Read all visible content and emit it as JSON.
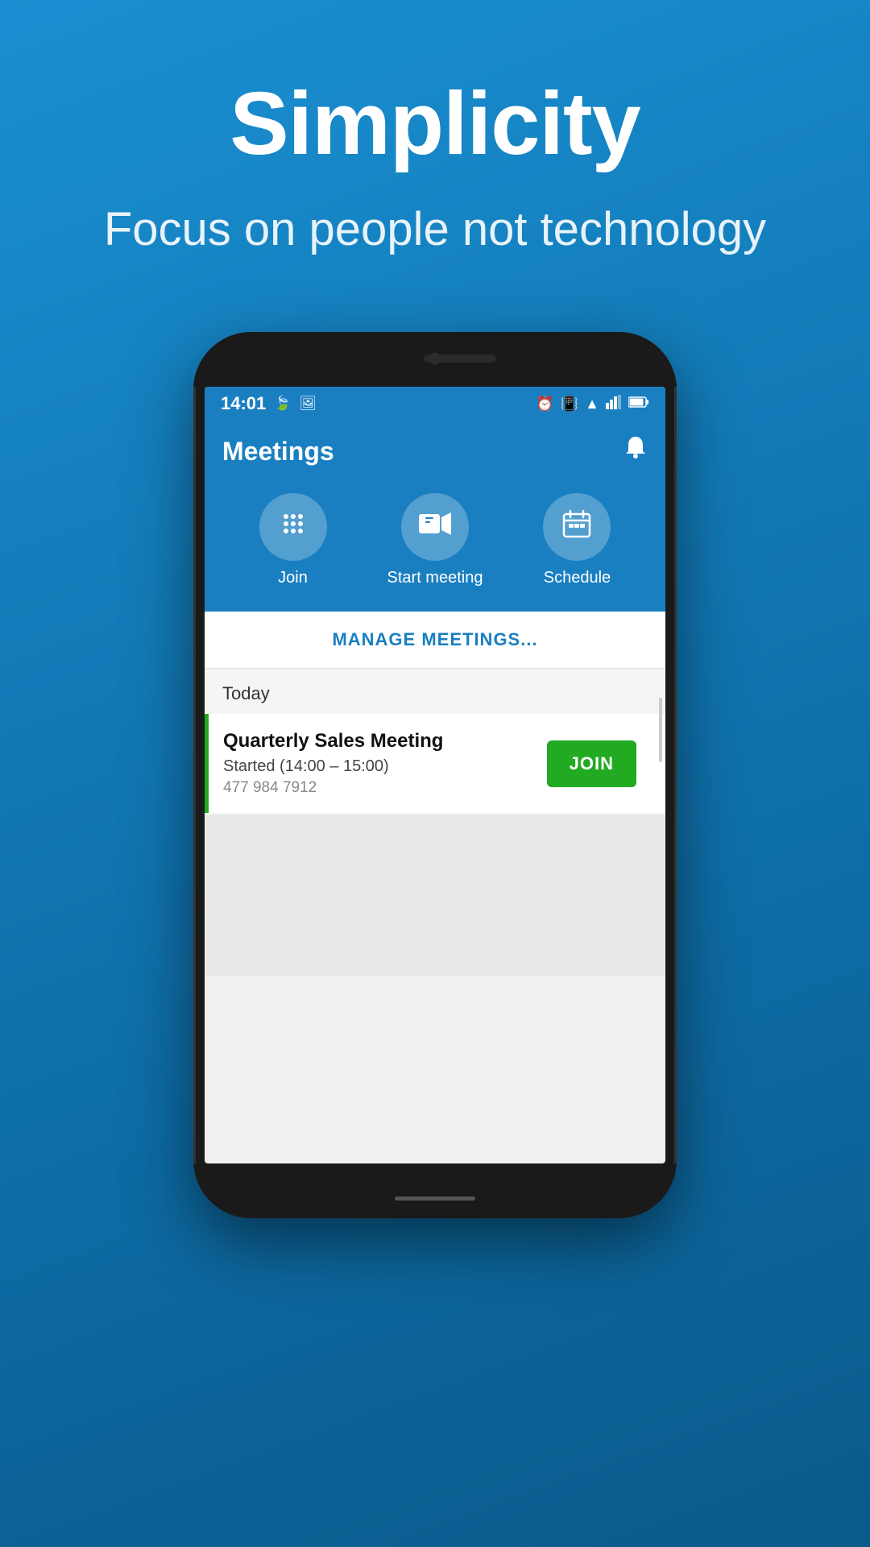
{
  "hero": {
    "title": "Simplicity",
    "subtitle": "Focus on people not technology"
  },
  "phone": {
    "status_bar": {
      "time": "14:01",
      "left_icons": [
        "🍃",
        "🖼"
      ],
      "right_icons": [
        "⏰",
        "📳",
        "▲",
        "◀",
        "🔋"
      ]
    },
    "app": {
      "title": "Meetings",
      "bell_icon": "🔔"
    },
    "action_buttons": [
      {
        "id": "join",
        "label": "Join",
        "icon": "⠿"
      },
      {
        "id": "start-meeting",
        "label": "Start meeting",
        "icon": "🖥"
      },
      {
        "id": "schedule",
        "label": "Schedule",
        "icon": "📅"
      }
    ],
    "manage_meetings_label": "MANAGE MEETINGS...",
    "today_section": {
      "title": "Today",
      "meetings": [
        {
          "name": "Quarterly Sales Meeting",
          "time": "Started (14:00 – 15:00)",
          "number": "477 984 7912",
          "join_label": "JOIN"
        }
      ]
    }
  }
}
